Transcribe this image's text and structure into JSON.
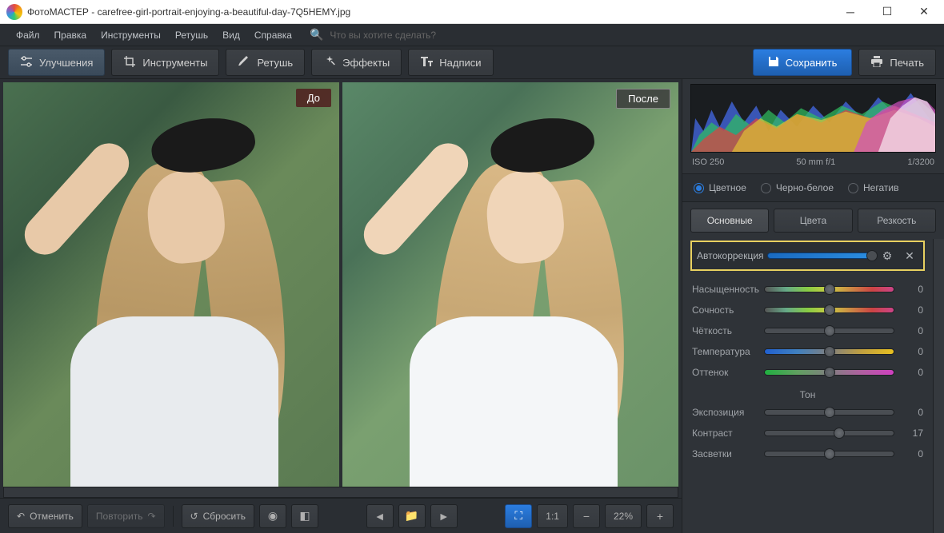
{
  "window": {
    "title": "ФотоМАСТЕР - carefree-girl-portrait-enjoying-a-beautiful-day-7Q5HEMY.jpg"
  },
  "menu": {
    "file": "Файл",
    "edit": "Правка",
    "tools": "Инструменты",
    "retouch": "Ретушь",
    "view": "Вид",
    "help": "Справка",
    "search_placeholder": "Что вы хотите сделать?"
  },
  "tabs": {
    "enhance": "Улучшения",
    "tools": "Инструменты",
    "retouch": "Ретушь",
    "effects": "Эффекты",
    "text": "Надписи"
  },
  "actions": {
    "save": "Сохранить",
    "print": "Печать"
  },
  "compare": {
    "before": "До",
    "after": "После"
  },
  "bottom": {
    "undo": "Отменить",
    "redo": "Повторить",
    "reset": "Сбросить",
    "ratio": "1:1",
    "zoom": "22%"
  },
  "exif": {
    "iso": "ISO 250",
    "focal": "50 mm f/1",
    "shutter": "1/3200"
  },
  "modes": {
    "color": "Цветное",
    "bw": "Черно-белое",
    "negative": "Негатив"
  },
  "subtabs": {
    "basic": "Основные",
    "colors": "Цвета",
    "sharp": "Резкость"
  },
  "auto": {
    "label": "Автокоррекция"
  },
  "sliders": {
    "saturation": {
      "label": "Насыщенность",
      "value": "0",
      "pos": 50
    },
    "vibrance": {
      "label": "Сочность",
      "value": "0",
      "pos": 50
    },
    "clarity": {
      "label": "Чёткость",
      "value": "0",
      "pos": 50
    },
    "temperature": {
      "label": "Температура",
      "value": "0",
      "pos": 50
    },
    "tint": {
      "label": "Оттенок",
      "value": "0",
      "pos": 50
    },
    "tone_header": "Тон",
    "exposure": {
      "label": "Экспозиция",
      "value": "0",
      "pos": 50
    },
    "contrast": {
      "label": "Контраст",
      "value": "17",
      "pos": 58
    },
    "highlights": {
      "label": "Засветки",
      "value": "0",
      "pos": 50
    }
  }
}
